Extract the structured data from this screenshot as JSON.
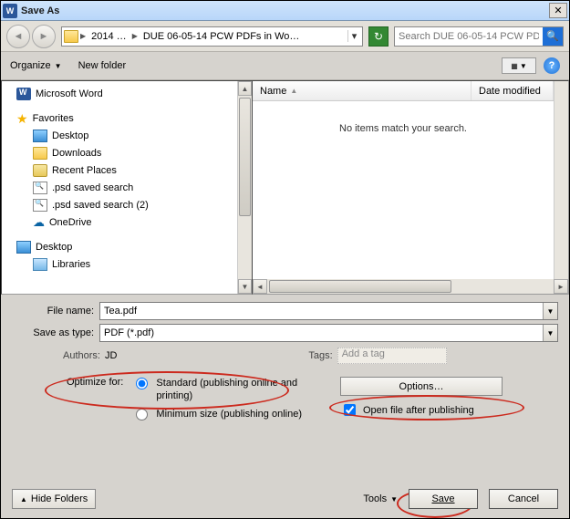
{
  "titlebar": {
    "app_glyph": "W",
    "title": "Save As",
    "close_glyph": "✕"
  },
  "nav": {
    "back_glyph": "◄",
    "forward_glyph": "►",
    "path_seg1": "2014 …",
    "path_seg2": "DUE 06-05-14 PCW PDFs in Wo…",
    "refresh_glyph": "↻",
    "search_placeholder": "Search DUE 06-05-14 PCW PD…",
    "search_glyph": "🔍"
  },
  "toolbar": {
    "organize": "Organize",
    "newfolder": "New folder",
    "views_glyph": "▦",
    "help_glyph": "?"
  },
  "navpane": {
    "msword": "Microsoft Word",
    "favorites": "Favorites",
    "fav_items": [
      "Desktop",
      "Downloads",
      "Recent Places",
      ".psd saved search",
      ".psd saved search (2)",
      "OneDrive"
    ],
    "desktop": "Desktop",
    "libraries": "Libraries"
  },
  "list": {
    "col_name": "Name",
    "col_date": "Date modified",
    "empty_msg": "No items match your search."
  },
  "form": {
    "filename_label": "File name:",
    "filename_value": "Tea.pdf",
    "savetype_label": "Save as type:",
    "savetype_value": "PDF (*.pdf)",
    "authors_label": "Authors:",
    "authors_value": "JD",
    "tags_label": "Tags:",
    "tags_placeholder": "Add a tag",
    "optimize_label": "Optimize for:",
    "opt_standard": "Standard (publishing online and printing)",
    "opt_minimum": "Minimum size (publishing online)",
    "options_btn": "Options…",
    "openafter": "Open file after publishing"
  },
  "footer": {
    "hide_folders": "Hide Folders",
    "tools": "Tools",
    "save": "Save",
    "cancel": "Cancel"
  }
}
